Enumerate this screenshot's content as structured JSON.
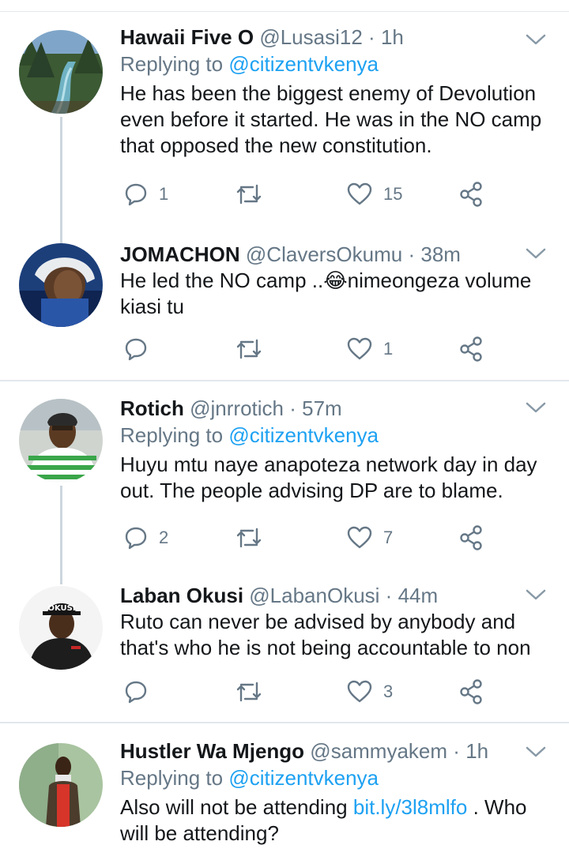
{
  "tweets": [
    {
      "name": "Hawaii Five O",
      "handle": "@Lusasi12",
      "dot": "·",
      "time": "1h",
      "replying_prefix": "Replying to",
      "replying_to": "@citizentvkenya",
      "text": "He has been the biggest enemy of Devolution even before it started. He was in the NO camp that opposed the new constitution.",
      "replies": "1",
      "retweets": "",
      "likes": "15",
      "avatar_icon": "river-landscape-avatar"
    },
    {
      "name": "JOMACHON",
      "handle": "@ClaversOkumu",
      "dot": "·",
      "time": "38m",
      "text_before_emoji": "He led the NO camp ..",
      "emoji": "😂",
      "text_after_emoji": "nimeongeza volume kiasi tu",
      "replies": "",
      "retweets": "",
      "likes": "1",
      "avatar_icon": "person-blue-hoodie-avatar"
    },
    {
      "name": "Rotich",
      "handle": "@jnrrotich",
      "dot": "·",
      "time": "57m",
      "replying_prefix": "Replying to",
      "replying_to": "@citizentvkenya",
      "text": "Huyu mtu naye anapoteza network day in day out. The people advising DP are to blame.",
      "replies": "2",
      "retweets": "",
      "likes": "7",
      "avatar_icon": "person-striped-shirt-avatar"
    },
    {
      "name": "Laban Okusi",
      "handle": "@LabanOkusi",
      "dot": "·",
      "time": "44m",
      "text": "Ruto can never be advised by anybody and that's who he is not being accountable to non",
      "replies": "",
      "retweets": "",
      "likes": "3",
      "avatar_icon": "person-cap-avatar",
      "avatar_cap_text": "OKUSI"
    },
    {
      "name": "Hustler Wa Mjengo",
      "handle": "@sammyakem",
      "dot": "·",
      "time": "1h",
      "replying_prefix": "Replying to",
      "replying_to": "@citizentvkenya",
      "text_before_link": "Also will not be attending ",
      "link": "bit.ly/3l8mlfo",
      "text_after_link": " . Who will be attending?",
      "avatar_icon": "person-red-shirt-avatar"
    }
  ],
  "colors": {
    "primary_text": "#14171a",
    "secondary_text": "#657786",
    "link": "#1da1f2",
    "divider": "#e1e8ed",
    "thread_line": "#ccd6dd"
  }
}
